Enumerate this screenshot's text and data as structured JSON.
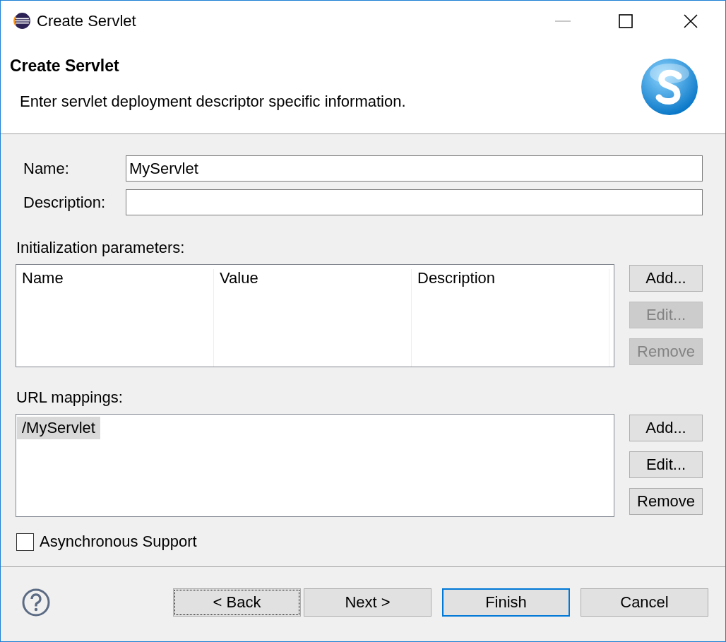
{
  "window": {
    "title": "Create Servlet"
  },
  "header": {
    "title": "Create Servlet",
    "description": "Enter servlet deployment descriptor specific information."
  },
  "fields": [
    {
      "label": "Name:",
      "value": "MyServlet"
    },
    {
      "label": "Description:"
    }
  ],
  "init_parameters": {
    "label": "Initialization parameters:",
    "columns": [
      "Name",
      "Value",
      "Description"
    ],
    "buttons": [
      {
        "label": "Add...",
        "disabled": false
      },
      {
        "label": "Edit...",
        "disabled": true
      },
      {
        "label": "Remove",
        "disabled": true
      }
    ]
  },
  "url_mappings": {
    "label": "URL mappings:",
    "rows": [
      {
        "text": "/MyServlet",
        "selected": true
      }
    ],
    "buttons": [
      {
        "label": "Add...",
        "disabled": false
      },
      {
        "label": "Edit...",
        "disabled": false
      },
      {
        "label": "Remove",
        "disabled": false
      }
    ]
  },
  "async_support": {
    "label": "Asynchronous Support",
    "checked": false
  },
  "footer_buttons": [
    {
      "label": "< Back",
      "focused": true,
      "default": false
    },
    {
      "label": "Next >",
      "focused": false,
      "default": false
    },
    {
      "label": "Finish",
      "focused": false,
      "default": true
    },
    {
      "label": "Cancel",
      "focused": false,
      "default": false
    }
  ]
}
